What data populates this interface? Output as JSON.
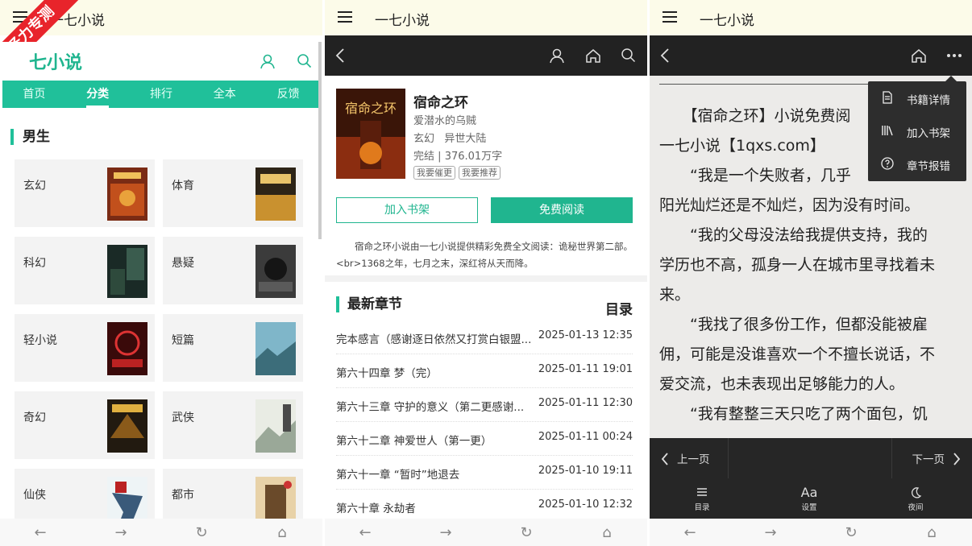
{
  "left": {
    "app_title": "一七小说",
    "ribbon": "圣力专测",
    "logo": "七小说",
    "tabs": [
      "首页",
      "分类",
      "排行",
      "全本",
      "反馈"
    ],
    "active_tab": "分类",
    "section": "男生",
    "categories": [
      "玄幻",
      "体育",
      "科幻",
      "悬疑",
      "轻小说",
      "短篇",
      "奇幻",
      "武侠",
      "仙侠",
      "都市"
    ],
    "icons": [
      "user-icon",
      "search-icon"
    ]
  },
  "middle": {
    "app_title": "一七小说",
    "book": {
      "title": "宿命之环",
      "author": "爱潜水的乌贼",
      "genre": "玄幻",
      "subgenre": "异世大陆",
      "status": "完结",
      "separator": "|",
      "words": "376.01万字",
      "tag1": "我要催更",
      "tag2": "我要推荐",
      "cover_text": "宿命之环"
    },
    "btn_shelf": "加入书架",
    "btn_read": "免费阅读",
    "description": "宿命之环小说由一七小说提供精彩免费全文阅读：诡秘世界第二部。<br>1368之年，七月之末，深红将从天而降。",
    "latest_title": "最新章节",
    "catalog_label": "目录",
    "chapters": [
      {
        "name": "完本感言（感谢逐日依然又打赏白银盟...",
        "date": "2025-01-13 12:35"
      },
      {
        "name": "第六十四章 梦（完）",
        "date": "2025-01-11 19:01"
      },
      {
        "name": "第六十三章 守护的意义（第二更感谢...",
        "date": "2025-01-11 12:30"
      },
      {
        "name": "第六十二章 神爱世人（第一更）",
        "date": "2025-01-11 00:24"
      },
      {
        "name": "第六十一章 “暂时”地退去",
        "date": "2025-01-10 19:11"
      },
      {
        "name": "第六十章 永劫者",
        "date": "2025-01-10 12:32"
      }
    ]
  },
  "right": {
    "app_title": "一七小说",
    "paragraphs": [
      "　　【宿命之环】小说免费阅",
      "一七小说【1qxs.com】",
      "　　“我是一个失败者，几乎",
      "阳光灿烂还是不灿烂，因为没有时间。",
      "　　“我的父母没法给我提供支持，我的",
      "学历也不高，孤身一人在城市里寻找着未",
      "来。",
      "　　“我找了很多份工作，但都没能被雇",
      "佣，可能是没谁喜欢一个不擅长说话，不",
      "爱交流，也未表现出足够能力的人。",
      "　　“我有整整三天只吃了两个面包，饥"
    ],
    "menu_items": [
      "书籍详情",
      "加入书架",
      "章节报错"
    ],
    "prev_page": "上一页",
    "next_page": "下一页",
    "tool_catalog": "目录",
    "tool_settings": "设置",
    "tool_night": "夜间",
    "settings_glyph": "Aa"
  },
  "nav_arrows": {
    "back": "←",
    "forward": "→",
    "reload": "↻",
    "home": "⌂"
  }
}
